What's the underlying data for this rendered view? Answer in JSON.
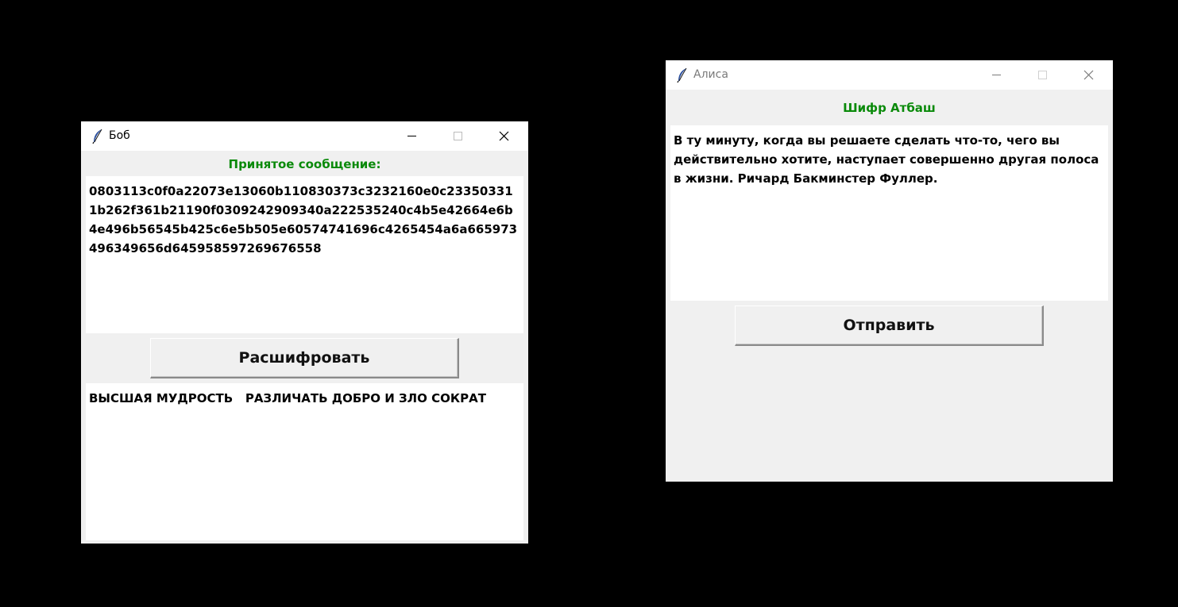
{
  "bob": {
    "title": "Боб",
    "heading": "Принятое сообщение:",
    "received_text": "0803113c0f0a22073e13060b110830373c3232160e0c233503311b262f361b21190f0309242909340a222535240c4b5e42664e6b4e496b56545b425c6e5b505e60574741696c4265454a6a665973496349656d645958597269676558",
    "decrypt_button": "Расшифровать",
    "decrypted_text": "ВЫСШАЯ МУДРОСТЬ   РАЗЛИЧАТЬ ДОБРО И ЗЛО СОКРАТ"
  },
  "alice": {
    "title": "Алиса",
    "heading": "Шифр Атбаш",
    "message_text": "В ту минуту, когда вы решаете сделать что-то, чего вы действительно хотите, наступает совершенно другая полоса в жизни. Ричард Бакминстер Фуллер.",
    "send_button": "Отправить"
  },
  "icons": {
    "app_icon": "feather-icon",
    "minimize": "minimize-icon",
    "maximize": "maximize-icon",
    "close": "close-icon"
  },
  "colors": {
    "desktop": "#000000",
    "heading_green": "#0a8a0a",
    "window_bg": "#f0f0f0"
  }
}
